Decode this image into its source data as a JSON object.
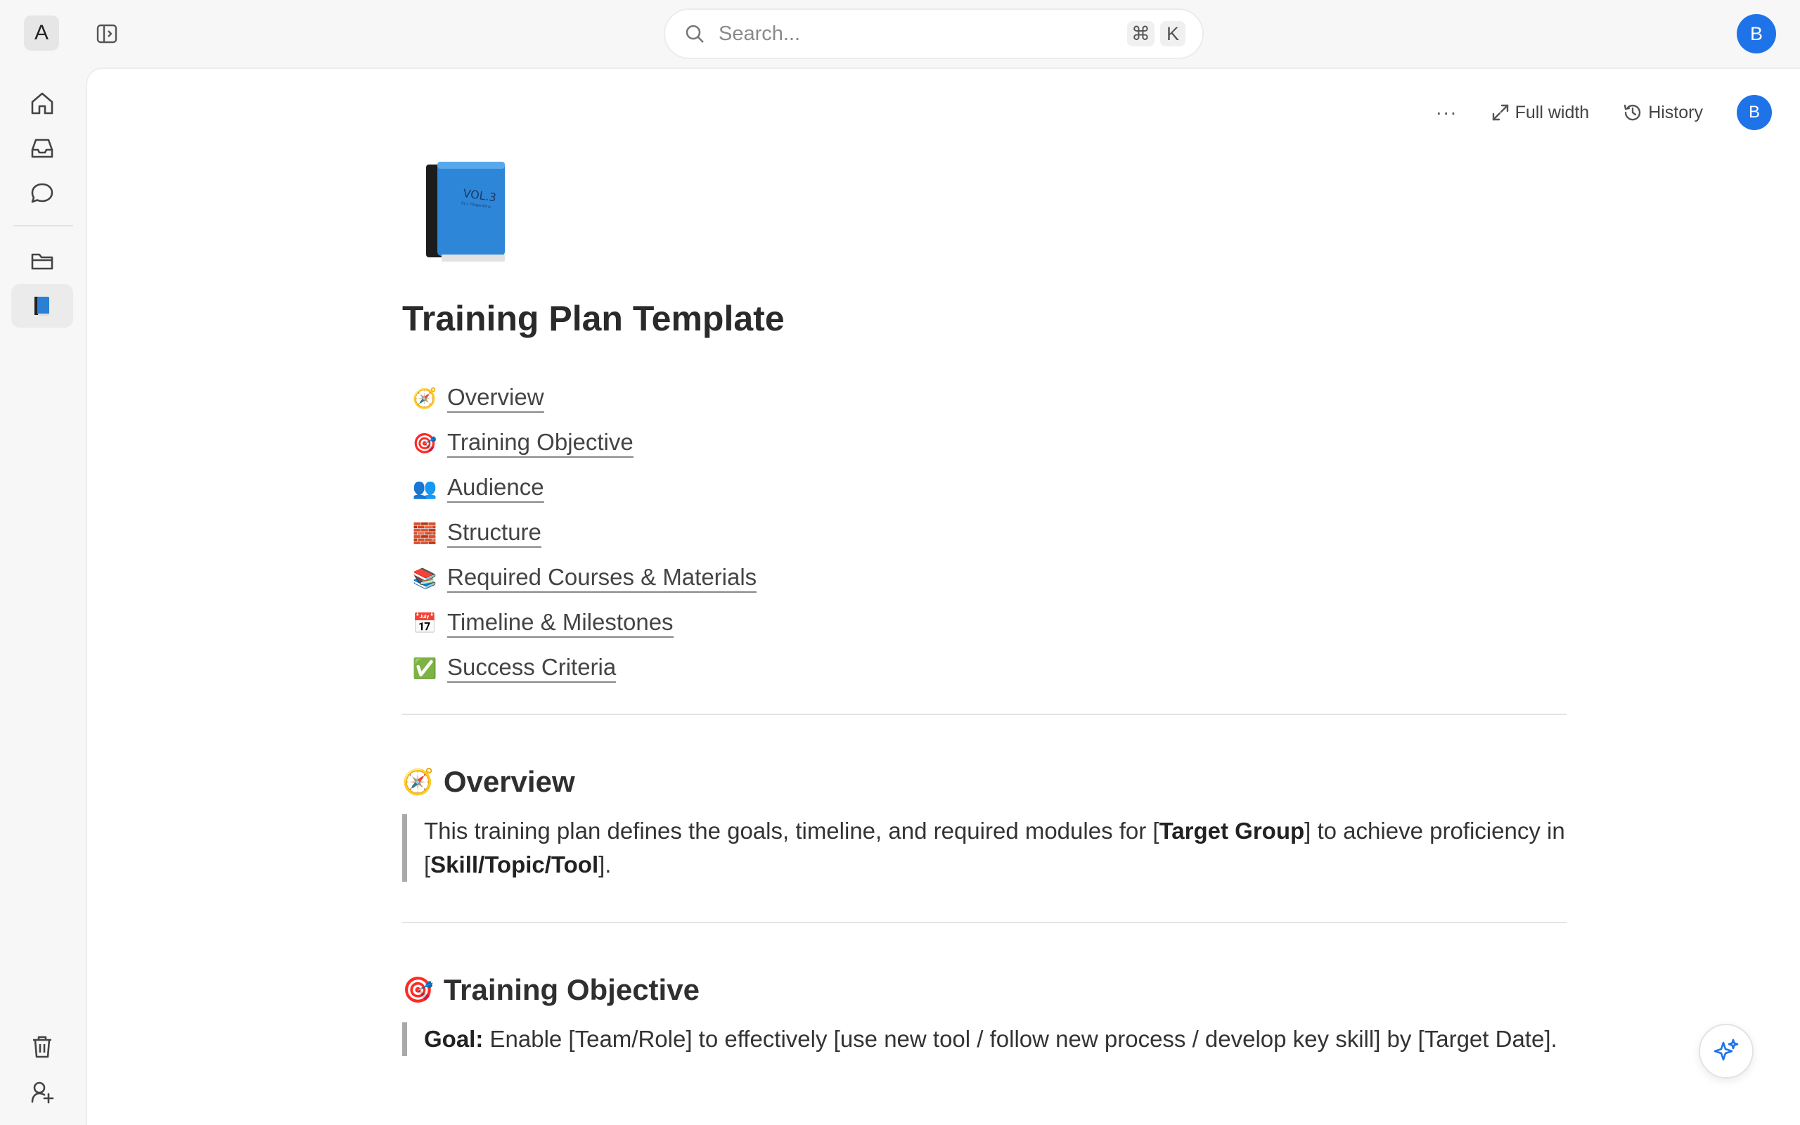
{
  "topbar": {
    "workspace_initial": "A",
    "search_placeholder": "Search...",
    "shortcut_cmd": "⌘",
    "shortcut_key": "K",
    "user_initial": "B"
  },
  "rail": {
    "items": [
      "home-icon",
      "inbox-icon",
      "chat-icon",
      "folder-icon",
      "book-icon"
    ],
    "bottom": [
      "trash-icon",
      "add-member-icon"
    ]
  },
  "doc_toolbar": {
    "more": "···",
    "full_width": "Full width",
    "history": "History",
    "user_initial": "B"
  },
  "document": {
    "title": "Training Plan Template",
    "toc": [
      {
        "emoji": "🧭",
        "label": "Overview"
      },
      {
        "emoji": "🎯",
        "label": "Training Objective"
      },
      {
        "emoji": "👥",
        "label": "Audience"
      },
      {
        "emoji": "🧱",
        "label": "Structure"
      },
      {
        "emoji": "📚",
        "label": "Required Courses & Materials"
      },
      {
        "emoji": "📅",
        "label": "Timeline & Milestones"
      },
      {
        "emoji": "✅",
        "label": "Success Criteria"
      }
    ],
    "sections": {
      "overview": {
        "emoji": "🧭",
        "heading": "Overview",
        "text_1": "This training plan defines the goals, timeline, and required modules for [",
        "bold_1": "Target Group",
        "text_2": "] to achieve proficiency in [",
        "bold_2": "Skill/Topic/Tool",
        "text_3": "]."
      },
      "objective": {
        "emoji": "🎯",
        "heading": "Training Objective",
        "goal_label": "Goal:",
        "goal_text": " Enable [Team/Role] to effectively [use new tool / follow new process / develop key skill] by [Target Date]."
      }
    }
  },
  "colors": {
    "accent": "#1e73e8",
    "page_bg": "#f7f7f7",
    "content_bg": "#ffffff"
  }
}
